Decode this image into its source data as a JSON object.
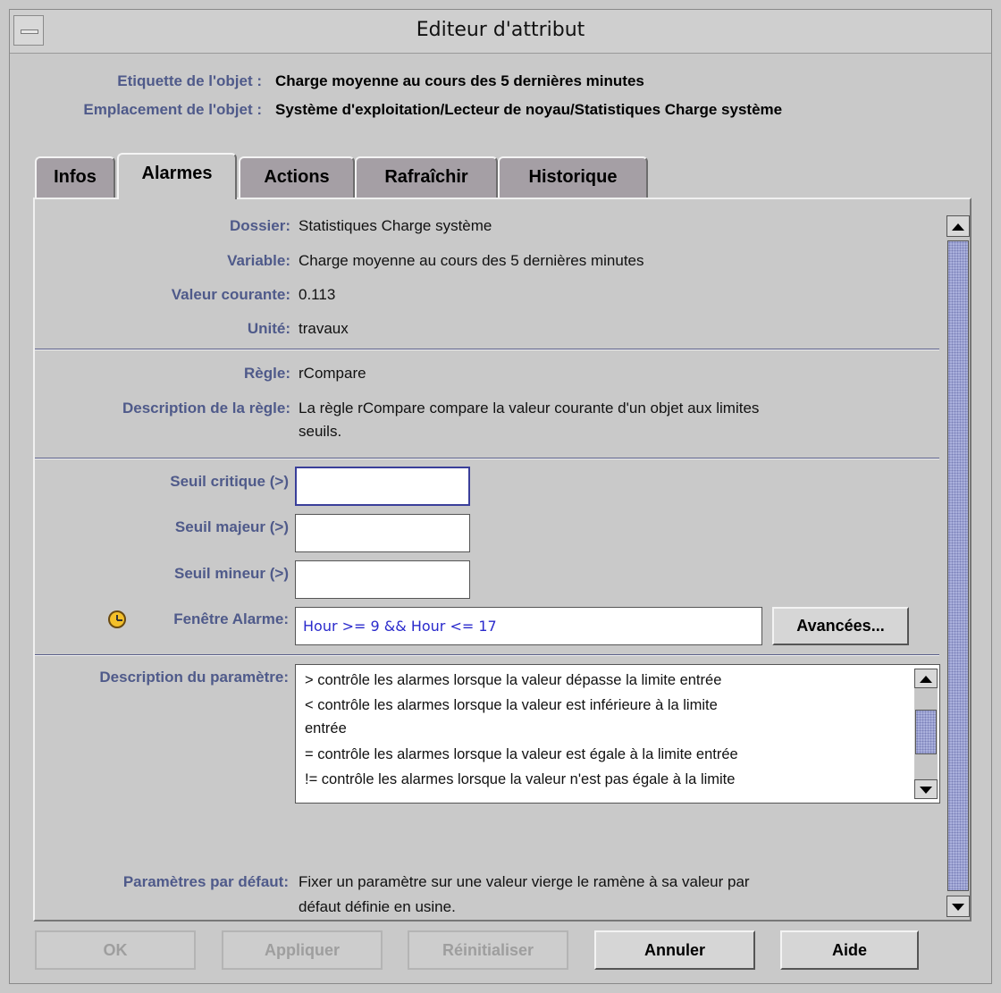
{
  "window": {
    "title": "Editeur d'attribut"
  },
  "object": {
    "label_caption": "Etiquette de l'objet :",
    "label_value": "Charge moyenne au cours des 5 dernières minutes",
    "location_caption": "Emplacement de l'objet :",
    "location_value": "Système d'exploitation/Lecteur de noyau/Statistiques Charge système"
  },
  "tabs": [
    {
      "label": "Infos"
    },
    {
      "label": "Alarmes",
      "active": true
    },
    {
      "label": "Actions"
    },
    {
      "label": "Rafraîchir"
    },
    {
      "label": "Historique"
    }
  ],
  "fields": {
    "dossier": {
      "label": "Dossier:",
      "value": "Statistiques Charge système"
    },
    "variable": {
      "label": "Variable:",
      "value": "Charge moyenne au cours des 5 dernières minutes"
    },
    "valeur": {
      "label": "Valeur courante:",
      "value": "0.113"
    },
    "unite": {
      "label": "Unité:",
      "value": "travaux"
    },
    "regle": {
      "label": "Règle:",
      "value": "rCompare"
    },
    "description_regle": {
      "label": "Description de la règle:",
      "line1": "La règle rCompare compare la valeur courante d'un objet aux limites",
      "line2": "seuils."
    }
  },
  "thresholds": {
    "critique": {
      "label": "Seuil critique (>)",
      "value": ""
    },
    "majeur": {
      "label": "Seuil majeur (>)",
      "value": ""
    },
    "mineur": {
      "label": "Seuil mineur (>)",
      "value": ""
    }
  },
  "alarm_window": {
    "label": "Fenêtre Alarme:",
    "value": "Hour >= 9 && Hour <= 17",
    "button": "Avancées..."
  },
  "param_description": {
    "label": "Description du paramètre:",
    "lines": [
      "> contrôle les alarmes lorsque la valeur dépasse la limite entrée",
      "< contrôle les alarmes lorsque la valeur est inférieure à la limite",
      "entrée",
      "= contrôle les alarmes lorsque la valeur est égale à la limite entrée",
      "!= contrôle les alarmes lorsque la valeur n'est pas égale à la limite"
    ]
  },
  "defaults": {
    "label": "Paramètres par défaut:",
    "line1": "Fixer un paramètre sur une valeur vierge le ramène à sa valeur par",
    "line2": "défaut définie en usine."
  },
  "buttons": {
    "ok": "OK",
    "apply": "Appliquer",
    "reset": "Réinitialiser",
    "cancel": "Annuler",
    "help": "Aide"
  },
  "icons": {
    "window_menu": "window-menu-icon",
    "alarm_clock": "clock-icon",
    "scroll_up": "arrow-up-icon",
    "scroll_down": "arrow-down-icon"
  }
}
